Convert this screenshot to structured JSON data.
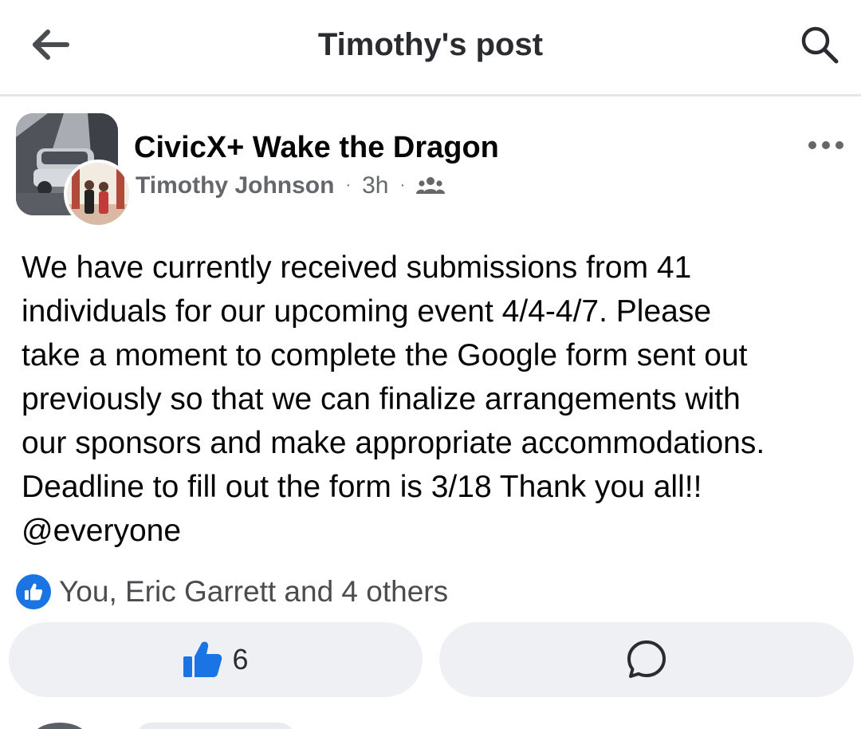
{
  "header": {
    "title": "Timothy's post",
    "back_icon": "arrow-left-icon",
    "search_icon": "search-icon"
  },
  "post": {
    "group_name": "CivicX+ Wake the Dragon",
    "author": "Timothy Johnson",
    "separator": "·",
    "time": "3h",
    "audience_icon": "group-members-icon",
    "more_icon": "more-horizontal-icon",
    "body_lines": [
      "We have currently received submissions from 41",
      "individuals for our upcoming event 4/4-4/7. Please",
      "take a moment to complete the Google form sent out",
      "previously so that we can finalize arrangements with",
      "our sponsors and make appropriate accommodations.",
      "Deadline to fill out the form is 3/18 Thank you all!!",
      "@everyone"
    ]
  },
  "reactions": {
    "icon": "like-reaction-icon",
    "summary": "You, Eric Garrett and 4 others"
  },
  "actions": {
    "like_icon": "thumbs-up-icon",
    "like_count": "6",
    "comment_icon": "comment-bubble-icon"
  },
  "colors": {
    "accent": "#1b74e4",
    "text_primary": "#050505",
    "text_secondary": "#65676b",
    "button_bg": "#eef0f3",
    "divider": "#e4e6ea"
  }
}
